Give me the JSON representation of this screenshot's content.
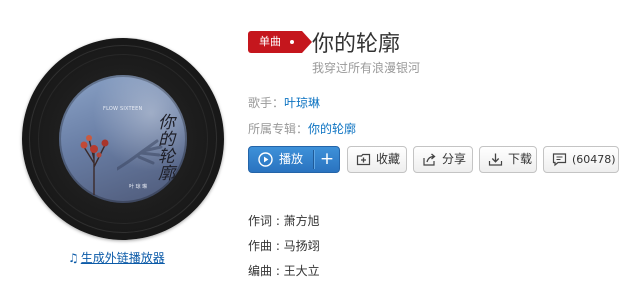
{
  "cover": {
    "brand": "FLOW SIXTEEN",
    "title_art": "你的轮廓",
    "small_text": "叶 琼 琳"
  },
  "player_link": "生成外链播放器",
  "badge": "单曲",
  "song": {
    "title": "你的轮廓",
    "subtitle": "我穿过所有浪漫银河"
  },
  "artist": {
    "label": "歌手：",
    "value": "叶琼琳"
  },
  "album": {
    "label": "所属专辑：",
    "value": "你的轮廓"
  },
  "actions": {
    "play": "播放",
    "add": "+",
    "collect": "收藏",
    "share": "分享",
    "download": "下载",
    "comment": "(60478)"
  },
  "credits": [
    "作词 : 萧方旭",
    "作曲 : 马扬翊",
    "编曲 : 王大立"
  ],
  "colors": {
    "badge_red": "#c5161d",
    "play_blue": "#2a73c0",
    "link_blue": "#0c73c2"
  }
}
